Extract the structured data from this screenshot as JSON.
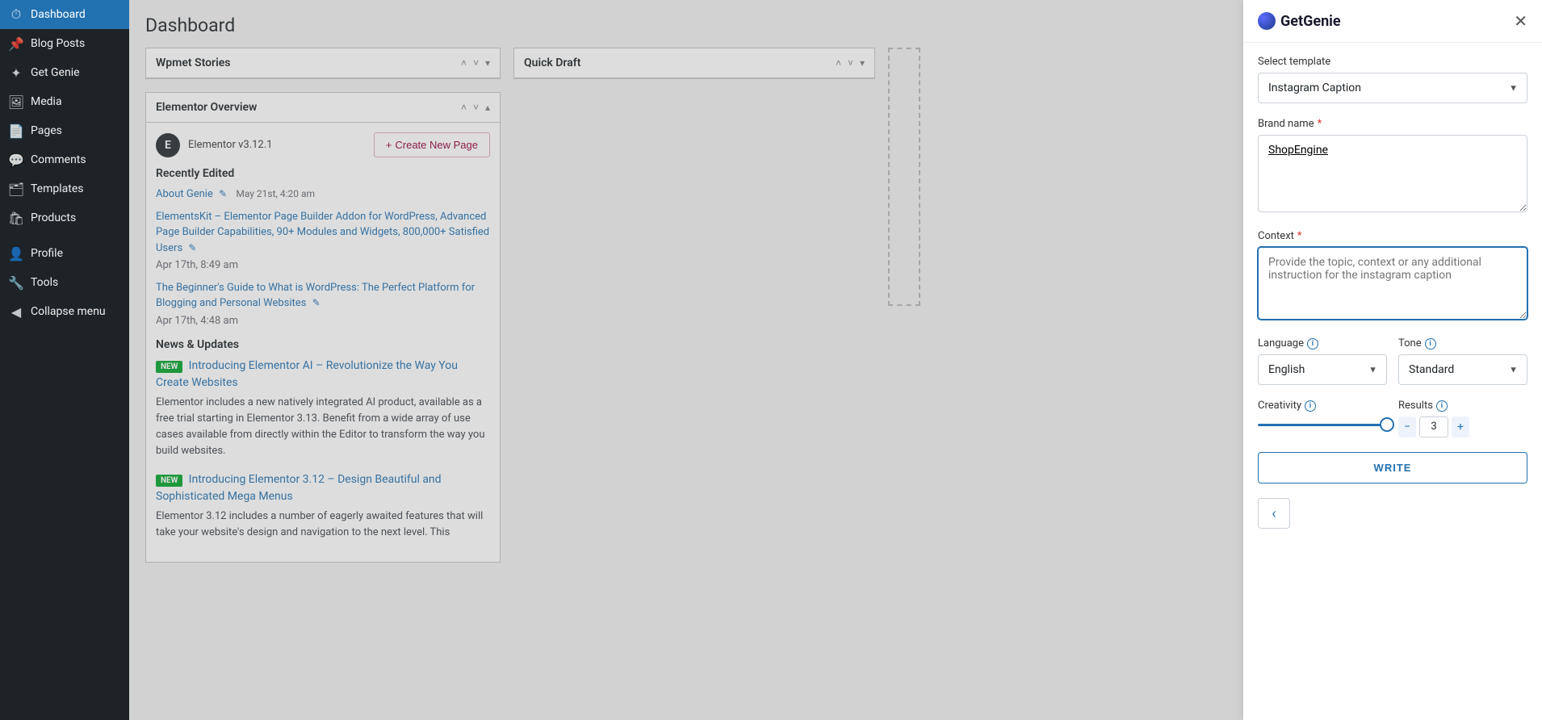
{
  "sidebar": {
    "items": [
      {
        "label": "Dashboard",
        "icon": "⌂"
      },
      {
        "label": "Blog Posts",
        "icon": "📌"
      },
      {
        "label": "Get Genie",
        "icon": "✦"
      },
      {
        "label": "Media",
        "icon": "🖼"
      },
      {
        "label": "Pages",
        "icon": "📄"
      },
      {
        "label": "Comments",
        "icon": "💬"
      },
      {
        "label": "Templates",
        "icon": "🗂"
      },
      {
        "label": "Products",
        "icon": "🛍"
      },
      {
        "label": "Profile",
        "icon": "👤"
      },
      {
        "label": "Tools",
        "icon": "🔧"
      },
      {
        "label": "Collapse menu",
        "icon": "◀"
      }
    ]
  },
  "page_title": "Dashboard",
  "boxes": {
    "wpmet": {
      "title": "Wpmet Stories"
    },
    "quickdraft": {
      "title": "Quick Draft"
    },
    "elementor": {
      "title": "Elementor Overview",
      "version": "Elementor v3.12.1",
      "create_btn": "Create New Page",
      "recently_edited": "Recently Edited",
      "items": [
        {
          "title": "About Genie",
          "date": "May 21st, 4:20 am"
        },
        {
          "title": "ElementsKit – Elementor Page Builder Addon for WordPress, Advanced Page Builder Capabilities, 90+ Modules and Widgets, 800,000+ Satisfied Users",
          "date": "Apr 17th, 8:49 am"
        },
        {
          "title": "The Beginner's Guide to What is WordPress: The Perfect Platform for Blogging and Personal Websites",
          "date": "Apr 17th, 4:48 am"
        }
      ],
      "news_heading": "News & Updates",
      "news": [
        {
          "title": "Introducing Elementor AI – Revolutionize the Way You Create Websites",
          "desc": "Elementor includes a new natively integrated AI product, available as a free trial starting in Elementor 3.13. Benefit from a wide array of use cases available from directly within the Editor to transform the way you build websites."
        },
        {
          "title": "Introducing Elementor 3.12 – Design Beautiful and Sophisticated Mega Menus",
          "desc": "Elementor 3.12 includes a number of eagerly awaited features that will take your website's design and navigation to the next level. This"
        }
      ],
      "badge": "NEW"
    }
  },
  "panel": {
    "brand": "GetGenie",
    "select_template_label": "Select template",
    "template_value": "Instagram Caption",
    "brand_name_label": "Brand name",
    "brand_name_value": "ShopEngine",
    "context_label": "Context",
    "context_placeholder": "Provide the topic, context or any additional instruction for the instagram caption",
    "language_label": "Language",
    "language_value": "English",
    "tone_label": "Tone",
    "tone_value": "Standard",
    "creativity_label": "Creativity",
    "results_label": "Results",
    "results_value": "3",
    "write_label": "WRITE"
  }
}
